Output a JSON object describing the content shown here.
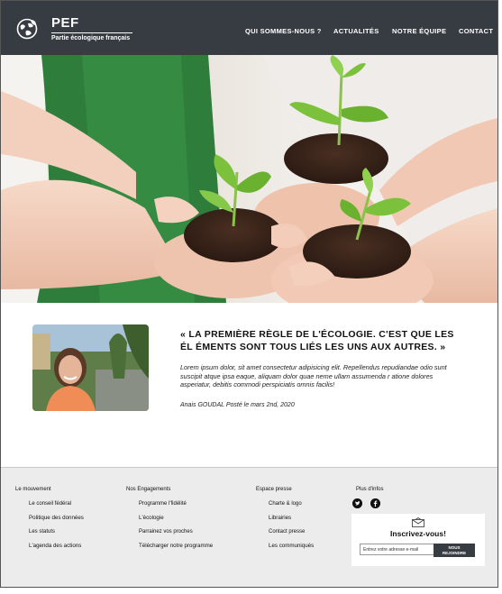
{
  "header": {
    "brand": "PEF",
    "tagline": "Partie écologique français",
    "logo_icon": "globe-leaf-icon",
    "background_color": "#373c43",
    "nav": [
      {
        "label": "QUI SOMMES-NOUS ?"
      },
      {
        "label": "ACTUALITÉS"
      },
      {
        "label": "NOTRE ÉQUIPE"
      },
      {
        "label": "CONTACT"
      }
    ]
  },
  "hero": {
    "subject": "hands holding soil with seedlings"
  },
  "quote": {
    "title": "« LA PREMIÈRE RÈGLE DE L'ÉCOLOGIE. C'EST QUE LES ÉL ÉMENTS SONT TOUS LIÉS LES UNS AUX AUTRES. »",
    "body": "Lorem ipsum dolor, sit amet consectetur adipisicing elit. Repellendus repudiandae odio sunt suscipit atque ipsa eaque, aliquam dolor quae neme ullam assumenda r atione dolores asperiatur, debitis commodi perspiciatis omnis facilis!",
    "author": "Anais GOUDAL Posté le mars 2nd, 2020"
  },
  "footer": {
    "columns": [
      {
        "heading": "Le mouvement",
        "links": [
          "Le conseil fédéral",
          "Politique des données",
          "Les statuts",
          "L'agenda des actions"
        ]
      },
      {
        "heading": "Nos Engagements",
        "links": [
          "Programme l'fidélité",
          "L'écologie",
          "Parrainez vos proches",
          "Télécharger notre programme"
        ]
      },
      {
        "heading": "Espace presse",
        "links": [
          "Charte & logo",
          "Librairies",
          "Contact presse",
          "Les communiqués"
        ]
      }
    ],
    "social": {
      "heading": "Plus d'infos",
      "icons": [
        "twitter-icon",
        "facebook-icon"
      ]
    },
    "newsletter": {
      "icon": "mail-icon",
      "title": "Inscrivez-vous!",
      "placeholder": "Entrez votre adresse e-mail",
      "button_line1": "NOUS",
      "button_line2": "REJOINDRE",
      "button_color": "#373c43"
    }
  }
}
